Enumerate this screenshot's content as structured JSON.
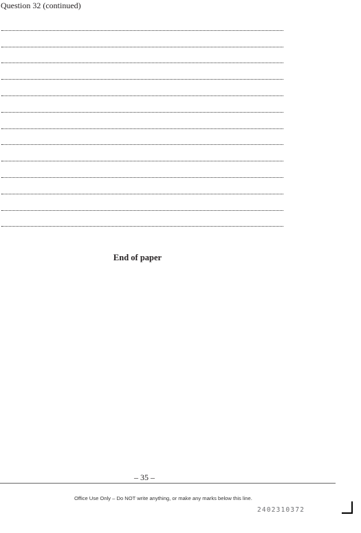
{
  "heading": "Question 32 (continued)",
  "answer_line_count": 13,
  "end_text": "End of paper",
  "page_number": "– 35 –",
  "office_note": "Office Use Only – Do NOT write anything, or make any marks below this line.",
  "barcode_number": "2402310372"
}
